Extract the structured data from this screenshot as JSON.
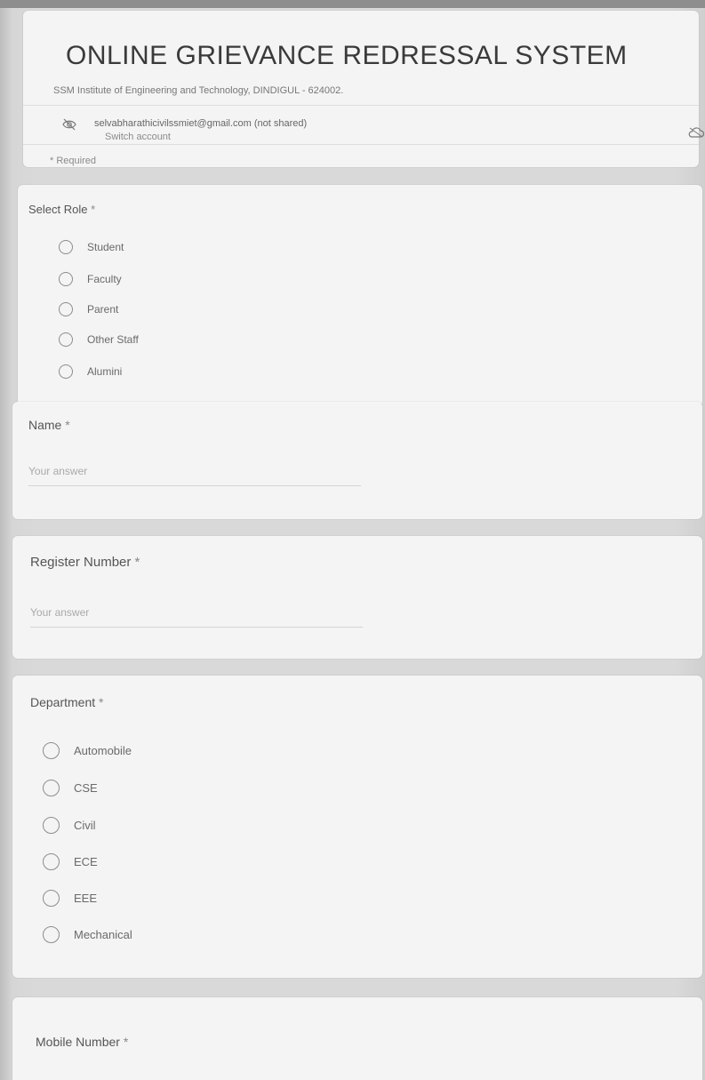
{
  "form": {
    "title": "ONLINE GRIEVANCE REDRESSAL SYSTEM",
    "institute": "SSM Institute of Engineering and Technology, DINDIGUL - 624002.",
    "account_email": "selvabharathicivilssmiet@gmail.com (not shared)",
    "switch_account": "Switch account",
    "required_note": "* Required"
  },
  "questions": {
    "role": {
      "label": "Select Role",
      "required_mark": " *",
      "options": [
        "Student",
        "Faculty",
        "Parent",
        "Other Staff",
        "Alumini"
      ]
    },
    "name": {
      "label": "Name",
      "required_mark": " *",
      "placeholder": "Your answer"
    },
    "register_number": {
      "label": "Register Number",
      "required_mark": " *",
      "placeholder": "Your answer"
    },
    "department": {
      "label": "Department",
      "required_mark": " *",
      "options": [
        "Automobile",
        "CSE",
        "Civil",
        "ECE",
        "EEE",
        "Mechanical"
      ]
    },
    "mobile_number": {
      "label": "Mobile Number",
      "required_mark": " *"
    }
  },
  "icons": {
    "account": "eye-off-icon",
    "cloud": "cloud-icon"
  },
  "colors": {
    "background": "#d9d9d9",
    "card": "#f4f4f4",
    "text": "#555555"
  }
}
